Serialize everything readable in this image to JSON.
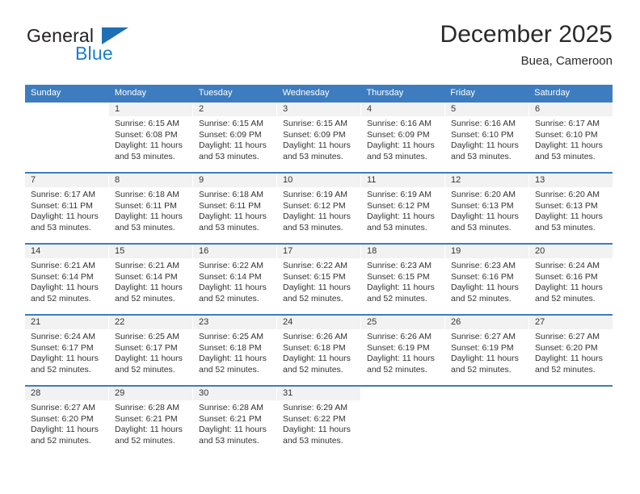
{
  "brand": {
    "name_top": "General",
    "name_bottom": "Blue",
    "triangle_color": "#1f6fb4",
    "top_color": "#231f20",
    "bottom_color": "#1b7fce"
  },
  "header": {
    "month_title": "December 2025",
    "location": "Buea, Cameroon"
  },
  "colors": {
    "header_band": "#3d7dbf",
    "daynum_band": "#f2f2f2",
    "text": "#333333"
  },
  "weekdays": [
    "Sunday",
    "Monday",
    "Tuesday",
    "Wednesday",
    "Thursday",
    "Friday",
    "Saturday"
  ],
  "weeks": [
    [
      {
        "day": "",
        "sunrise": "",
        "sunset": "",
        "daylight": "",
        "empty": true
      },
      {
        "day": "1",
        "sunrise": "Sunrise: 6:15 AM",
        "sunset": "Sunset: 6:08 PM",
        "daylight": "Daylight: 11 hours and 53 minutes."
      },
      {
        "day": "2",
        "sunrise": "Sunrise: 6:15 AM",
        "sunset": "Sunset: 6:09 PM",
        "daylight": "Daylight: 11 hours and 53 minutes."
      },
      {
        "day": "3",
        "sunrise": "Sunrise: 6:15 AM",
        "sunset": "Sunset: 6:09 PM",
        "daylight": "Daylight: 11 hours and 53 minutes."
      },
      {
        "day": "4",
        "sunrise": "Sunrise: 6:16 AM",
        "sunset": "Sunset: 6:09 PM",
        "daylight": "Daylight: 11 hours and 53 minutes."
      },
      {
        "day": "5",
        "sunrise": "Sunrise: 6:16 AM",
        "sunset": "Sunset: 6:10 PM",
        "daylight": "Daylight: 11 hours and 53 minutes."
      },
      {
        "day": "6",
        "sunrise": "Sunrise: 6:17 AM",
        "sunset": "Sunset: 6:10 PM",
        "daylight": "Daylight: 11 hours and 53 minutes."
      }
    ],
    [
      {
        "day": "7",
        "sunrise": "Sunrise: 6:17 AM",
        "sunset": "Sunset: 6:11 PM",
        "daylight": "Daylight: 11 hours and 53 minutes."
      },
      {
        "day": "8",
        "sunrise": "Sunrise: 6:18 AM",
        "sunset": "Sunset: 6:11 PM",
        "daylight": "Daylight: 11 hours and 53 minutes."
      },
      {
        "day": "9",
        "sunrise": "Sunrise: 6:18 AM",
        "sunset": "Sunset: 6:11 PM",
        "daylight": "Daylight: 11 hours and 53 minutes."
      },
      {
        "day": "10",
        "sunrise": "Sunrise: 6:19 AM",
        "sunset": "Sunset: 6:12 PM",
        "daylight": "Daylight: 11 hours and 53 minutes."
      },
      {
        "day": "11",
        "sunrise": "Sunrise: 6:19 AM",
        "sunset": "Sunset: 6:12 PM",
        "daylight": "Daylight: 11 hours and 53 minutes."
      },
      {
        "day": "12",
        "sunrise": "Sunrise: 6:20 AM",
        "sunset": "Sunset: 6:13 PM",
        "daylight": "Daylight: 11 hours and 53 minutes."
      },
      {
        "day": "13",
        "sunrise": "Sunrise: 6:20 AM",
        "sunset": "Sunset: 6:13 PM",
        "daylight": "Daylight: 11 hours and 53 minutes."
      }
    ],
    [
      {
        "day": "14",
        "sunrise": "Sunrise: 6:21 AM",
        "sunset": "Sunset: 6:14 PM",
        "daylight": "Daylight: 11 hours and 52 minutes."
      },
      {
        "day": "15",
        "sunrise": "Sunrise: 6:21 AM",
        "sunset": "Sunset: 6:14 PM",
        "daylight": "Daylight: 11 hours and 52 minutes."
      },
      {
        "day": "16",
        "sunrise": "Sunrise: 6:22 AM",
        "sunset": "Sunset: 6:14 PM",
        "daylight": "Daylight: 11 hours and 52 minutes."
      },
      {
        "day": "17",
        "sunrise": "Sunrise: 6:22 AM",
        "sunset": "Sunset: 6:15 PM",
        "daylight": "Daylight: 11 hours and 52 minutes."
      },
      {
        "day": "18",
        "sunrise": "Sunrise: 6:23 AM",
        "sunset": "Sunset: 6:15 PM",
        "daylight": "Daylight: 11 hours and 52 minutes."
      },
      {
        "day": "19",
        "sunrise": "Sunrise: 6:23 AM",
        "sunset": "Sunset: 6:16 PM",
        "daylight": "Daylight: 11 hours and 52 minutes."
      },
      {
        "day": "20",
        "sunrise": "Sunrise: 6:24 AM",
        "sunset": "Sunset: 6:16 PM",
        "daylight": "Daylight: 11 hours and 52 minutes."
      }
    ],
    [
      {
        "day": "21",
        "sunrise": "Sunrise: 6:24 AM",
        "sunset": "Sunset: 6:17 PM",
        "daylight": "Daylight: 11 hours and 52 minutes."
      },
      {
        "day": "22",
        "sunrise": "Sunrise: 6:25 AM",
        "sunset": "Sunset: 6:17 PM",
        "daylight": "Daylight: 11 hours and 52 minutes."
      },
      {
        "day": "23",
        "sunrise": "Sunrise: 6:25 AM",
        "sunset": "Sunset: 6:18 PM",
        "daylight": "Daylight: 11 hours and 52 minutes."
      },
      {
        "day": "24",
        "sunrise": "Sunrise: 6:26 AM",
        "sunset": "Sunset: 6:18 PM",
        "daylight": "Daylight: 11 hours and 52 minutes."
      },
      {
        "day": "25",
        "sunrise": "Sunrise: 6:26 AM",
        "sunset": "Sunset: 6:19 PM",
        "daylight": "Daylight: 11 hours and 52 minutes."
      },
      {
        "day": "26",
        "sunrise": "Sunrise: 6:27 AM",
        "sunset": "Sunset: 6:19 PM",
        "daylight": "Daylight: 11 hours and 52 minutes."
      },
      {
        "day": "27",
        "sunrise": "Sunrise: 6:27 AM",
        "sunset": "Sunset: 6:20 PM",
        "daylight": "Daylight: 11 hours and 52 minutes."
      }
    ],
    [
      {
        "day": "28",
        "sunrise": "Sunrise: 6:27 AM",
        "sunset": "Sunset: 6:20 PM",
        "daylight": "Daylight: 11 hours and 52 minutes."
      },
      {
        "day": "29",
        "sunrise": "Sunrise: 6:28 AM",
        "sunset": "Sunset: 6:21 PM",
        "daylight": "Daylight: 11 hours and 52 minutes."
      },
      {
        "day": "30",
        "sunrise": "Sunrise: 6:28 AM",
        "sunset": "Sunset: 6:21 PM",
        "daylight": "Daylight: 11 hours and 53 minutes."
      },
      {
        "day": "31",
        "sunrise": "Sunrise: 6:29 AM",
        "sunset": "Sunset: 6:22 PM",
        "daylight": "Daylight: 11 hours and 53 minutes."
      },
      {
        "day": "",
        "sunrise": "",
        "sunset": "",
        "daylight": "",
        "empty": true
      },
      {
        "day": "",
        "sunrise": "",
        "sunset": "",
        "daylight": "",
        "empty": true
      },
      {
        "day": "",
        "sunrise": "",
        "sunset": "",
        "daylight": "",
        "empty": true
      }
    ]
  ]
}
